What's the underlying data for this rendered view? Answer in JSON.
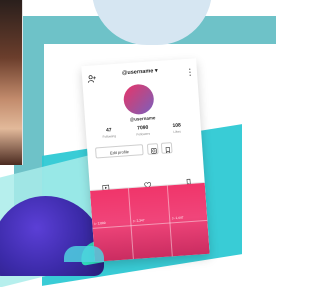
{
  "profile": {
    "username_menu": "@username ▾",
    "handle": "@username",
    "stats": [
      {
        "value": "47",
        "label": "Following"
      },
      {
        "value": "7090",
        "label": "Followers"
      },
      {
        "value": "108",
        "label": "Likes"
      }
    ],
    "edit_profile_label": "Edit profile"
  },
  "grid_cells": [
    {
      "views": "▷ 2,000"
    },
    {
      "views": "▷ 2,347"
    },
    {
      "views": "▷ 1,447"
    }
  ],
  "colors": {
    "frame": "#6ec2c8",
    "accent": "#2ec9d4",
    "grid_pink": "#f0356a",
    "avatar_start": "#e9336a",
    "avatar_end": "#7a5fc0"
  }
}
